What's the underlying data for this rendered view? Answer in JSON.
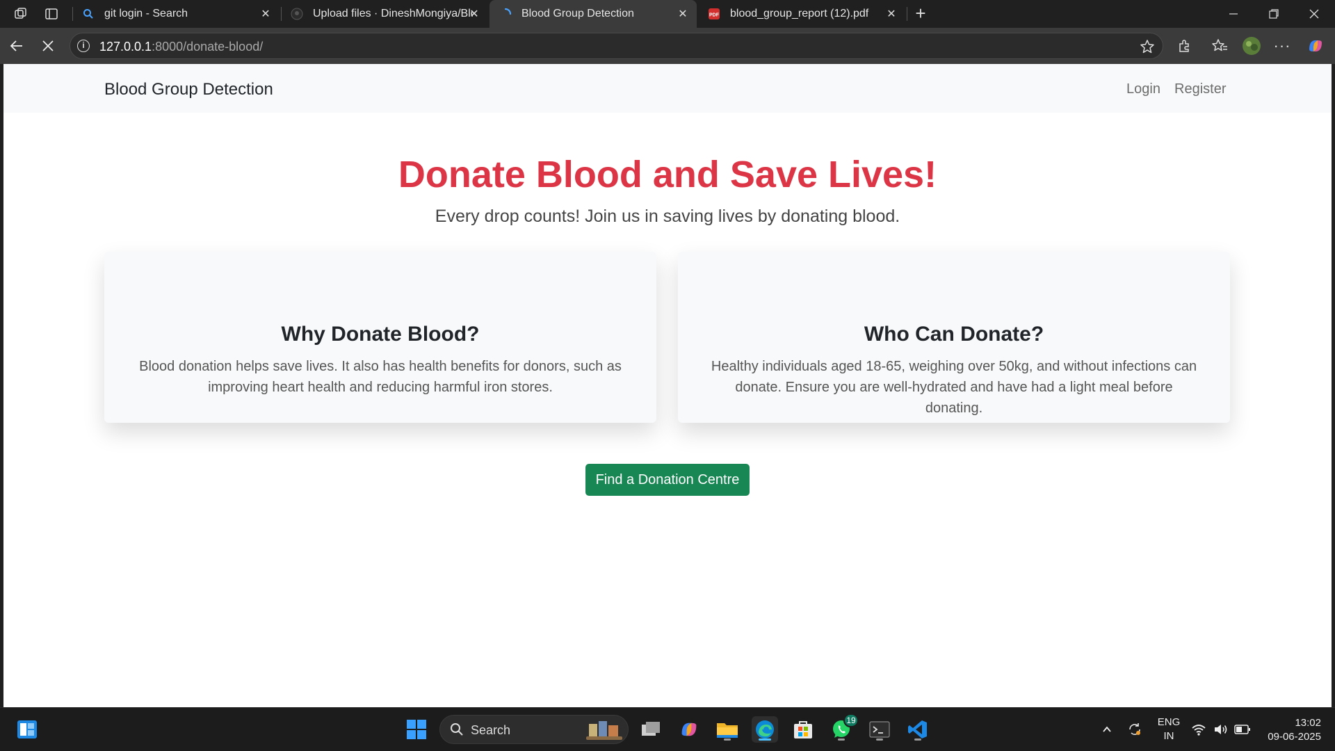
{
  "browser": {
    "tabs": [
      {
        "title": "git login - Search"
      },
      {
        "title": "Upload files · DineshMongiya/Blo"
      },
      {
        "title": "Blood Group Detection"
      },
      {
        "title": "blood_group_report (12).pdf"
      }
    ],
    "address": {
      "host": "127.0.0.1",
      "path": ":8000/donate-blood/"
    }
  },
  "page": {
    "brand": "Blood Group Detection",
    "nav": {
      "login": "Login",
      "register": "Register"
    },
    "hero": {
      "title": "Donate Blood and Save Lives!",
      "subtitle": "Every drop counts! Join us in saving lives by donating blood."
    },
    "cards": [
      {
        "title": "Why Donate Blood?",
        "text": "Blood donation helps save lives. It also has health benefits for donors, such as improving heart health and reducing harmful iron stores."
      },
      {
        "title": "Who Can Donate?",
        "text": "Healthy individuals aged 18-65, weighing over 50kg, and without infections can donate. Ensure you are well-hydrated and have had a light meal before donating."
      }
    ],
    "cta": "Find a Donation Centre",
    "colors": {
      "accent": "#dc3545",
      "button": "#198754",
      "navbar": "#f8f9fa"
    }
  },
  "taskbar": {
    "search_label": "Search",
    "whatsapp_badge": "19",
    "lang_top": "ENG",
    "lang_bottom": "IN",
    "time": "13:02",
    "date": "09-06-2025"
  }
}
